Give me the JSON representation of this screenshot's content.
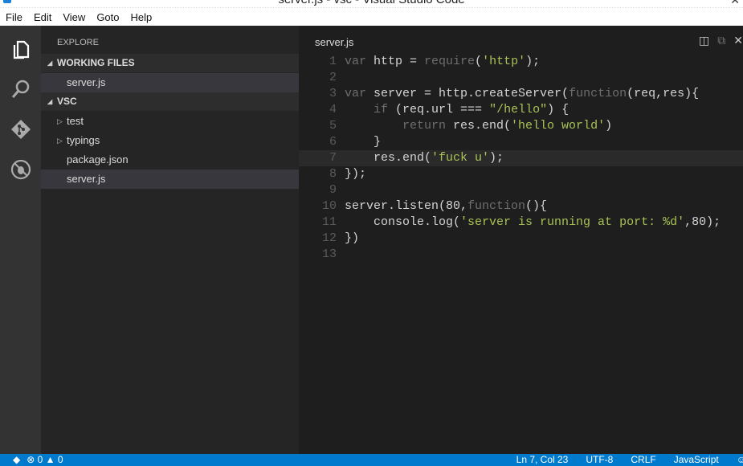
{
  "window": {
    "title": "server.js - vsc - Visual Studio Code"
  },
  "menu": [
    "File",
    "Edit",
    "View",
    "Goto",
    "Help"
  ],
  "activity": [
    {
      "icon": "files-icon"
    },
    {
      "icon": "search-icon"
    },
    {
      "icon": "git-icon"
    },
    {
      "icon": "debug-icon"
    }
  ],
  "sidebar": {
    "title": "EXPLORE",
    "working_files": {
      "label": "WORKING FILES",
      "items": [
        "server.js"
      ]
    },
    "project": {
      "label": "VSC",
      "items": [
        {
          "label": "test",
          "type": "folder"
        },
        {
          "label": "typings",
          "type": "folder"
        },
        {
          "label": "package.json",
          "type": "file"
        },
        {
          "label": "server.js",
          "type": "file",
          "selected": true
        }
      ]
    }
  },
  "editor": {
    "tab": "server.js",
    "current_line": 7,
    "lines": [
      [
        [
          "k",
          "var "
        ],
        [
          "p",
          "http = "
        ],
        [
          "k",
          "require"
        ],
        [
          "p",
          "("
        ],
        [
          "s",
          "'http'"
        ],
        [
          "p",
          ");"
        ]
      ],
      [],
      [
        [
          "k",
          "var "
        ],
        [
          "p",
          "server = http.createServer("
        ],
        [
          "k",
          "function"
        ],
        [
          "p",
          "(req,res){"
        ]
      ],
      [
        [
          "p",
          "    "
        ],
        [
          "k",
          "if "
        ],
        [
          "p",
          "(req.url === "
        ],
        [
          "s",
          "\"/hello\""
        ],
        [
          "p",
          ") {"
        ]
      ],
      [
        [
          "p",
          "        "
        ],
        [
          "k",
          "return "
        ],
        [
          "p",
          "res.end("
        ],
        [
          "s",
          "'hello world'"
        ],
        [
          "p",
          ")"
        ]
      ],
      [
        [
          "p",
          "    }"
        ]
      ],
      [
        [
          "p",
          "    res.end("
        ],
        [
          "s",
          "'fuck u'"
        ],
        [
          "p",
          ");"
        ]
      ],
      [
        [
          "p",
          "});"
        ]
      ],
      [],
      [
        [
          "p",
          "server.listen(80,"
        ],
        [
          "k",
          "function"
        ],
        [
          "p",
          "(){"
        ]
      ],
      [
        [
          "p",
          "    console.log("
        ],
        [
          "s",
          "'server is running at port: %d'"
        ],
        [
          "p",
          ",80);"
        ]
      ],
      [
        [
          "p",
          "})"
        ]
      ],
      []
    ]
  },
  "status": {
    "errors": "0",
    "warnings": "0",
    "position": "Ln 7, Col 23",
    "encoding": "UTF-8",
    "eol": "CRLF",
    "language": "JavaScript"
  }
}
